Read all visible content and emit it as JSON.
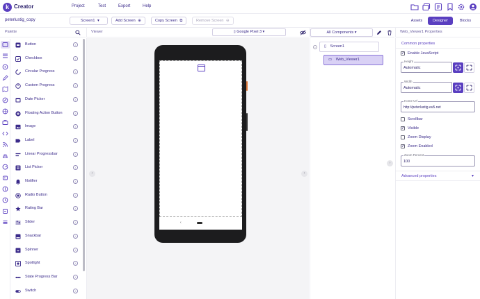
{
  "app": {
    "brand": "Creator",
    "logo_letter": "k"
  },
  "menu": [
    "Project",
    "Test",
    "Export",
    "Help"
  ],
  "project": {
    "name": "peterlustig_copy"
  },
  "toolbar": {
    "screen_label": "Screen1",
    "add_screen": "Add Screen",
    "copy_screen": "Copy Screen",
    "remove_screen": "Remove Screen"
  },
  "modes": [
    "Assets",
    "Designer",
    "Blocks"
  ],
  "active_mode": "Designer",
  "palette": {
    "title": "Palette",
    "items": [
      {
        "label": "Button",
        "icon": "button-icon"
      },
      {
        "label": "Checkbox",
        "icon": "checkbox-icon"
      },
      {
        "label": "Circular Progress",
        "icon": "circular-progress-icon"
      },
      {
        "label": "Custom Progress",
        "icon": "custom-progress-icon"
      },
      {
        "label": "Date Picker",
        "icon": "date-picker-icon"
      },
      {
        "label": "Floating Action Button",
        "icon": "fab-icon"
      },
      {
        "label": "Image",
        "icon": "image-icon"
      },
      {
        "label": "Label",
        "icon": "label-icon"
      },
      {
        "label": "Linear Progressbar",
        "icon": "linear-progress-icon"
      },
      {
        "label": "List Picker",
        "icon": "list-picker-icon"
      },
      {
        "label": "Notifier",
        "icon": "notifier-icon"
      },
      {
        "label": "Radio Button",
        "icon": "radio-button-icon"
      },
      {
        "label": "Rating Bar",
        "icon": "rating-bar-icon"
      },
      {
        "label": "Slider",
        "icon": "slider-icon"
      },
      {
        "label": "Snackbar",
        "icon": "snackbar-icon"
      },
      {
        "label": "Spinner",
        "icon": "spinner-icon"
      },
      {
        "label": "Spotlight",
        "icon": "spotlight-icon"
      },
      {
        "label": "State Progress Bar",
        "icon": "state-progress-icon"
      },
      {
        "label": "Switch",
        "icon": "switch-icon"
      }
    ],
    "info_glyph": "i"
  },
  "viewer": {
    "title": "Viewer",
    "device": "Google Pixel 3"
  },
  "components": {
    "title": "All Components",
    "tree": [
      {
        "label": "Screen1",
        "level": 0
      },
      {
        "label": "Web_Viewer1",
        "level": 1,
        "selected": true
      }
    ]
  },
  "properties": {
    "title": "Web_Viewer1 Properties",
    "common_label": "Common properties",
    "enable_js": {
      "label": "Enable JavaScript",
      "checked": true
    },
    "height": {
      "label": "Height",
      "value": "Automatic"
    },
    "width": {
      "label": "Width",
      "value": "Automatic"
    },
    "home_url": {
      "label": "Home Url",
      "value": "http://peterlustig.eu5.net"
    },
    "scrollbar": {
      "label": "Scrollbar",
      "checked": false
    },
    "visible": {
      "label": "Visible",
      "checked": true
    },
    "zoom_display": {
      "label": "Zoom Display",
      "checked": false
    },
    "zoom_enabled": {
      "label": "Zoom Enabled",
      "checked": true
    },
    "zoom_percent": {
      "label": "Zoom Percent",
      "value": "100"
    },
    "advanced_label": "Advanced properties"
  },
  "colors": {
    "accent": "#5a3fc0",
    "selected_bg": "#d9d1f5",
    "text": "#3a2a8a"
  }
}
